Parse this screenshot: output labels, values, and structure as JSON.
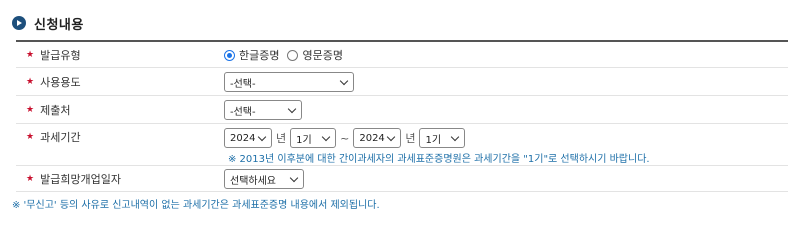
{
  "section": {
    "title": "신청내용"
  },
  "fields": {
    "issue_type": {
      "label": "발급유형",
      "options": [
        "한글증명",
        "영문증명"
      ],
      "selected": "한글증명"
    },
    "purpose": {
      "label": "사용용도",
      "value": "-선택-"
    },
    "submit_to": {
      "label": "제출처",
      "value": "-선택-"
    },
    "tax_period": {
      "label": "과세기간",
      "from_year": "2024",
      "year_unit": "년",
      "from_term": "1기",
      "range_sep": "~",
      "to_year": "2024",
      "to_term": "1기",
      "note": "※ 2013년 이후분에 대한 간이과세자의 과세표준증명원은 과세기간을 \"1기\"로 선택하시기 바랍니다."
    },
    "desired_date": {
      "label": "발급희망개업일자",
      "value": "선택하세요"
    }
  },
  "footnote": "※ '무신고' 등의 사유로 신고내역이 없는 과세기간은 과세표준증명 내용에서 제외됩니다.",
  "colors": {
    "required_mark": "#c8102e",
    "note_text": "#1d6fa8",
    "radio_accent": "#1a73e8",
    "section_bullet": "#1d4f7c"
  },
  "icons": {
    "section": "circle-arrow-icon",
    "required": "asterisk-icon",
    "dropdown": "chevron-down-icon"
  }
}
